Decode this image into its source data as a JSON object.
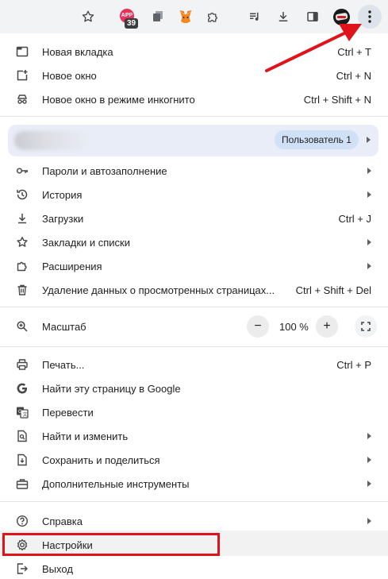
{
  "toolbar": {
    "ext_app_text": "APP",
    "ext_badge": "39"
  },
  "menu": {
    "items_top": [
      {
        "label": "Новая вкладка",
        "shortcut": "Ctrl + T"
      },
      {
        "label": "Новое окно",
        "shortcut": "Ctrl + N"
      },
      {
        "label": "Новое окно в режиме инкогнито",
        "shortcut": "Ctrl + Shift + N"
      }
    ],
    "profile": {
      "label": "Пользователь 1"
    },
    "items_mid": [
      {
        "label": "Пароли и автозаполнение",
        "shortcut": ""
      },
      {
        "label": "История",
        "shortcut": ""
      },
      {
        "label": "Загрузки",
        "shortcut": "Ctrl + J"
      },
      {
        "label": "Закладки и списки",
        "shortcut": ""
      },
      {
        "label": "Расширения",
        "shortcut": ""
      },
      {
        "label": "Удаление данных о просмотренных страницах...",
        "shortcut": "Ctrl + Shift + Del"
      }
    ],
    "zoom": {
      "label": "Масштаб",
      "value": "100 %",
      "minus": "−",
      "plus": "+"
    },
    "items_tools": [
      {
        "label": "Печать...",
        "shortcut": "Ctrl + P"
      },
      {
        "label": "Найти эту страницу в Google",
        "shortcut": ""
      },
      {
        "label": "Перевести",
        "shortcut": ""
      },
      {
        "label": "Найти и изменить",
        "shortcut": ""
      },
      {
        "label": "Сохранить и поделиться",
        "shortcut": ""
      },
      {
        "label": "Дополнительные инструменты",
        "shortcut": ""
      }
    ],
    "items_bottom": [
      {
        "label": "Справка",
        "shortcut": ""
      },
      {
        "label": "Настройки",
        "shortcut": ""
      },
      {
        "label": "Выход",
        "shortcut": ""
      }
    ]
  },
  "colors": {
    "highlight": "#e0131b",
    "accent": "#cfe0f7"
  },
  "icons": [
    "star-icon",
    "extension-icon",
    "metamask-icon",
    "puzzle-icon",
    "playlist-icon",
    "download-icon",
    "side-panel-icon",
    "kebab-menu-icon"
  ]
}
